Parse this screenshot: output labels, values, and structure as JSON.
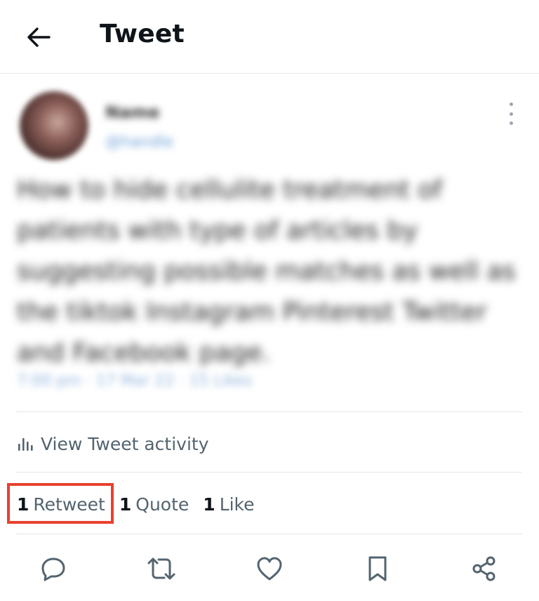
{
  "header": {
    "back_icon": "arrow-left-icon",
    "title": "Tweet"
  },
  "tweet": {
    "author_name": "Name",
    "author_handle": "@handle",
    "text": "How to hide cellulite treatment of patients with type of articles by suggesting possible matches as well as the tiktok Instagram Pinterest Twitter and Facebook page.",
    "meta": "7:00 pm · 17 Mar 22 · 15 Likes",
    "more_icon": "more-vertical-icon"
  },
  "activity": {
    "icon": "bar-chart-icon",
    "label": "View Tweet activity"
  },
  "stats": {
    "retweets": {
      "count": "1",
      "label": "Retweet"
    },
    "quotes": {
      "count": "1",
      "label": "Quote"
    },
    "likes": {
      "count": "1",
      "label": "Like"
    }
  },
  "actions": [
    {
      "icon": "reply-icon"
    },
    {
      "icon": "retweet-icon"
    },
    {
      "icon": "like-icon"
    },
    {
      "icon": "bookmark-icon"
    },
    {
      "icon": "share-icon"
    }
  ],
  "colors": {
    "highlight": "#e8412e",
    "secondary_text": "#53646f",
    "primary_text": "#0f1419"
  }
}
